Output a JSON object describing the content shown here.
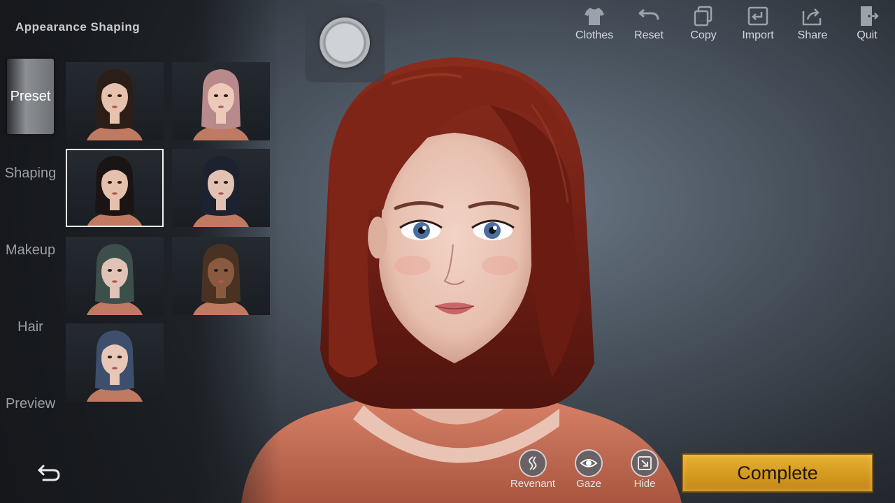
{
  "panel": {
    "title": "Appearance Shaping"
  },
  "nav": [
    {
      "label": "Preset",
      "active": true
    },
    {
      "label": "Shaping"
    },
    {
      "label": "Makeup"
    },
    {
      "label": "Hair"
    },
    {
      "label": "Preview"
    }
  ],
  "toolbar": {
    "clothes": "Clothes",
    "reset": "Reset",
    "copy": "Copy",
    "import": "Import",
    "share": "Share",
    "quit": "Quit"
  },
  "actions": {
    "revenant": "Revenant",
    "gaze": "Gaze",
    "hide": "Hide"
  },
  "complete_label": "Complete",
  "presets": [
    {
      "hair_color": "#2b1d17",
      "skin": "#e6c2ad",
      "selected": false
    },
    {
      "hair_color": "#b98a8c",
      "skin": "#ecc9b8",
      "selected": false
    },
    {
      "hair_color": "#1b1414",
      "skin": "#e4c0ad",
      "selected": true
    },
    {
      "hair_color": "#1c2230",
      "skin": "#e2c2b3",
      "selected": false
    },
    {
      "hair_color": "#3c4f4a",
      "skin": "#e0c3b6",
      "selected": false
    },
    {
      "hair_color": "#4a3222",
      "skin": "#8a5a40",
      "selected": false
    },
    {
      "hair_color": "#3e4f6e",
      "skin": "#e6c7b8",
      "selected": false
    }
  ],
  "colors": {
    "character_hair": "#7a2418",
    "complete_button": "#d9a02a"
  }
}
